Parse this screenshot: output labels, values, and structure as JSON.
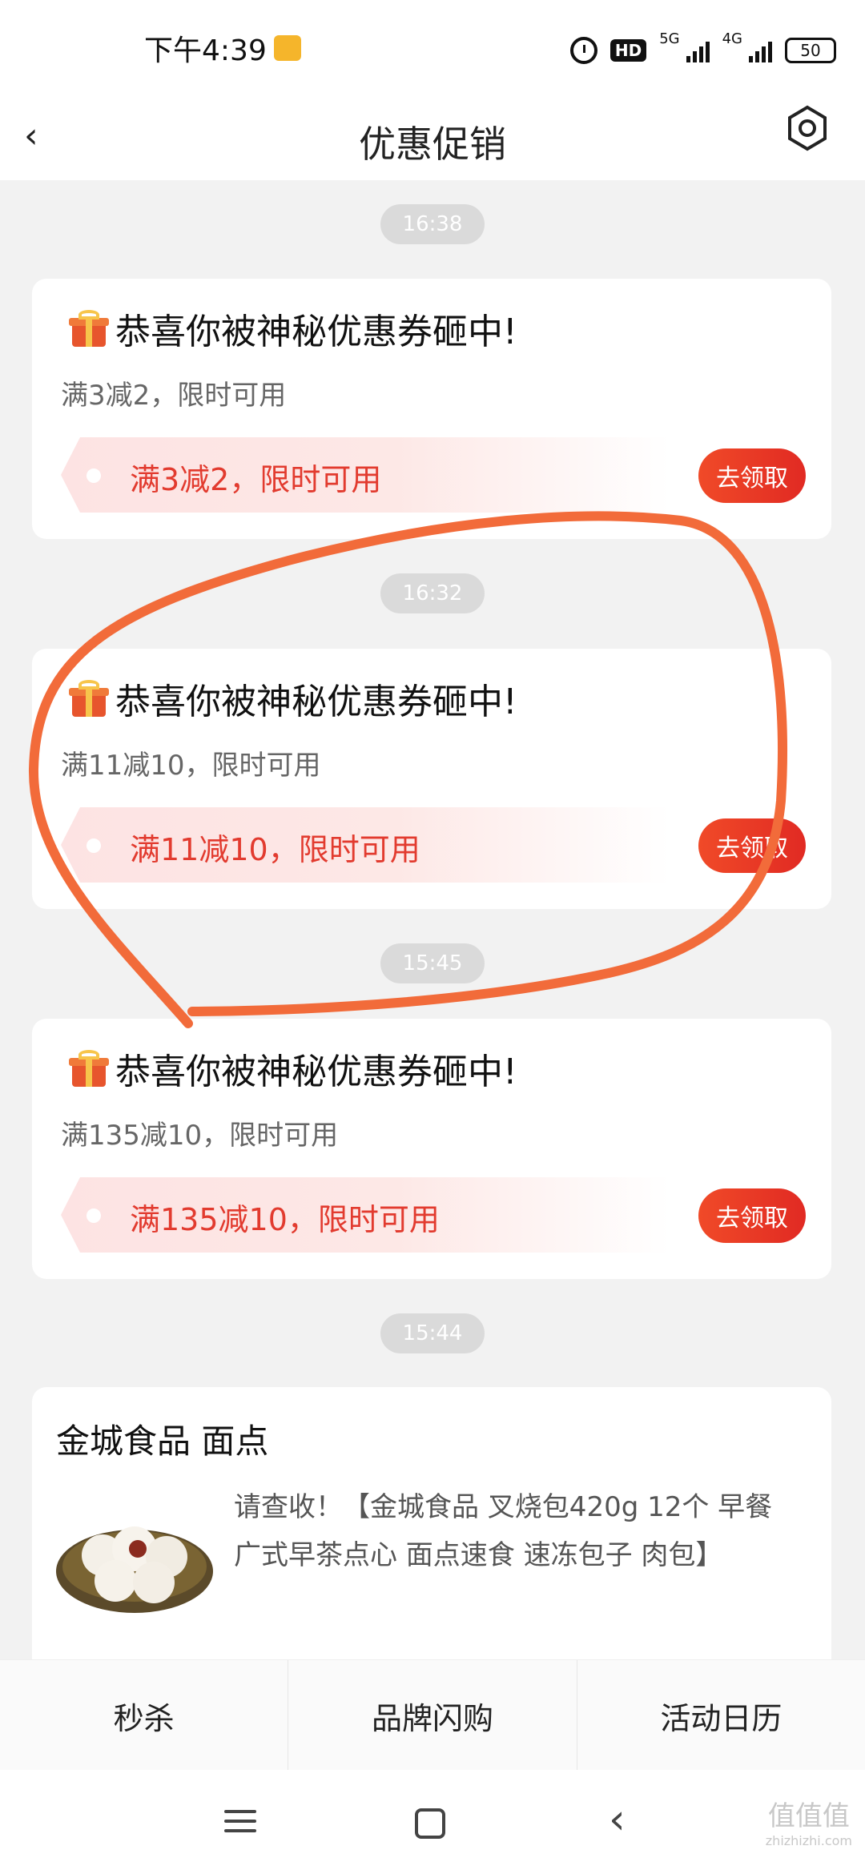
{
  "status_bar": {
    "time": "下午4:39",
    "hd": "HD",
    "net1": "5G",
    "net2": "4G",
    "battery": "50"
  },
  "header": {
    "title": "优惠促销"
  },
  "messages": [
    {
      "time": "16:38",
      "title": "恭喜你被神秘优惠券砸中!",
      "subtitle": "满3减2，限时可用",
      "coupon": "满3减2，限时可用",
      "button": "去领取"
    },
    {
      "time": "16:32",
      "title": "恭喜你被神秘优惠券砸中!",
      "subtitle": "满11减10，限时可用",
      "coupon": "满11减10，限时可用",
      "button": "去领取"
    },
    {
      "time": "15:45",
      "title": "恭喜你被神秘优惠券砸中!",
      "subtitle": "满135减10，限时可用",
      "coupon": "满135减10，限时可用",
      "button": "去领取"
    }
  ],
  "product_message": {
    "time": "15:44",
    "title": "金城食品 面点",
    "description": "请查收！【金城食品 叉烧包420g 12个 早餐 广式早茶点心 面点速食 速冻包子 肉包】"
  },
  "tabs": [
    "秒杀",
    "品牌闪购",
    "活动日历"
  ],
  "watermark": {
    "main": "值值值",
    "sub": "zhizhizhi.com"
  },
  "colors": {
    "accent": "#e12a23",
    "annotation": "#f26b3a"
  }
}
